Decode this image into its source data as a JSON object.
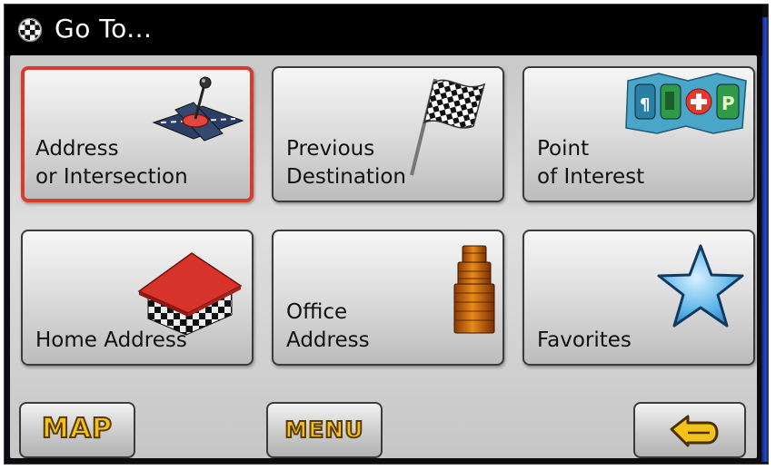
{
  "title_bar": {
    "title": "Go To...",
    "icon": "checkered-flag-ball-icon"
  },
  "tiles": [
    {
      "id": "address-or-intersection",
      "lines": [
        "Address",
        "or Intersection"
      ],
      "icon": "intersection-pin-icon",
      "selected": true
    },
    {
      "id": "previous-destination",
      "lines": [
        "Previous",
        "Destination"
      ],
      "icon": "checkered-flag-icon",
      "selected": false
    },
    {
      "id": "point-of-interest",
      "lines": [
        "Point",
        "of Interest"
      ],
      "icon": "poi-map-icon",
      "selected": false
    },
    {
      "id": "home-address",
      "lines": [
        "Home Address"
      ],
      "icon": "house-icon",
      "selected": false
    },
    {
      "id": "office-address",
      "lines": [
        "Office",
        "Address"
      ],
      "icon": "office-building-icon",
      "selected": false
    },
    {
      "id": "favorites",
      "lines": [
        "Favorites"
      ],
      "icon": "star-icon",
      "selected": false
    }
  ],
  "bottom_bar": {
    "map_label": "MAP",
    "menu_label": "MENU",
    "back_icon": "back-arrow-icon"
  },
  "colors": {
    "selected_border": "#d93b2a",
    "button_text": "#f3c21b",
    "title_background": "#000000"
  }
}
